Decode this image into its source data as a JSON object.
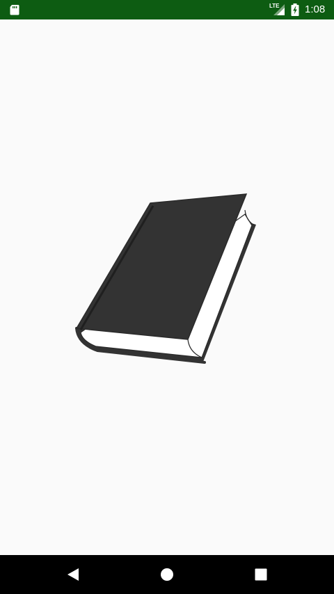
{
  "status_bar": {
    "background": "#0d5c12",
    "network_label": "LTE",
    "time": "1:08",
    "icons": [
      "sd-card-icon",
      "signal-icon",
      "battery-charging-icon"
    ]
  },
  "content": {
    "background": "#fafafa",
    "illustration": "book-icon"
  },
  "nav_bar": {
    "background": "#000000",
    "buttons": [
      "back",
      "home",
      "recents"
    ]
  }
}
